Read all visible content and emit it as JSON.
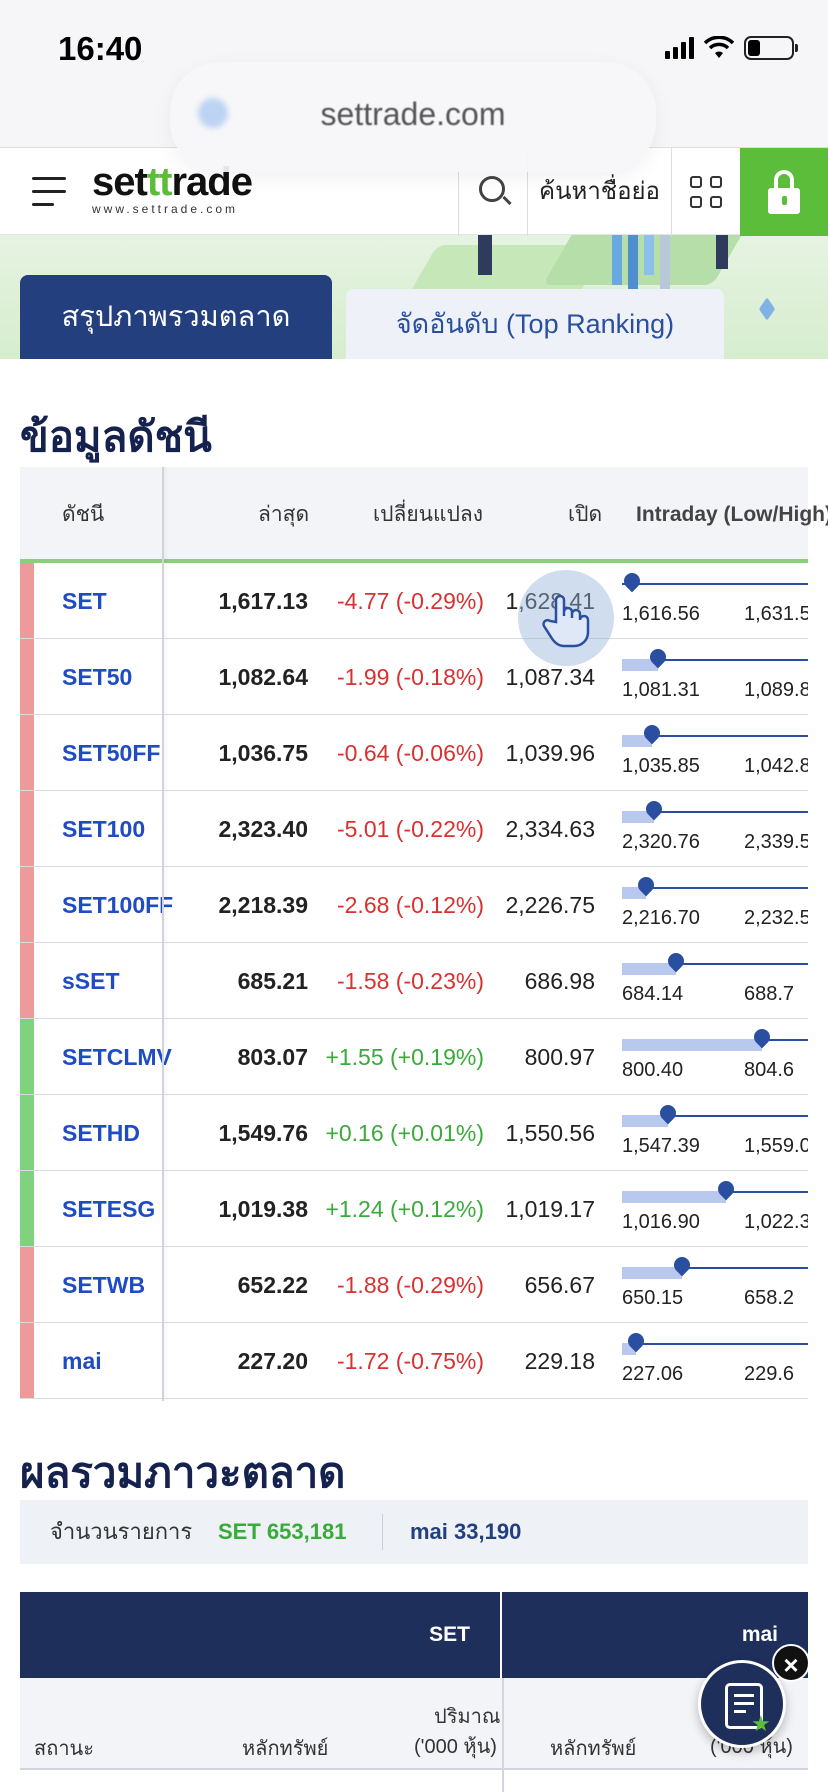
{
  "status_bar": {
    "time": "16:40"
  },
  "browser": {
    "url": "settrade.com"
  },
  "header": {
    "logo_main_a": "set",
    "logo_main_b": "tt",
    "logo_main_c": "rade",
    "logo_sub": "www.settrade.com",
    "symbol_search_label": "ค้นหาชื่อย่อ"
  },
  "tabs": {
    "active": "สรุปภาพรวมตลาด",
    "inactive": "จัดอันดับ (Top Ranking)"
  },
  "index_section": {
    "title": "ข้อมูลดัชนี",
    "headers": {
      "index": "ดัชนี",
      "last": "ล่าสุด",
      "change": "เปลี่ยนแปลง",
      "open": "เปิด",
      "intraday": "Intraday (Low/High)"
    },
    "rows": [
      {
        "symbol": "SET",
        "last": "1,617.13",
        "change": "-4.77 (-0.29%)",
        "open": "1,628.41",
        "low": "1,616.56",
        "high": "1,631.5",
        "direction": "down",
        "position": 0.05,
        "fill": 0.0
      },
      {
        "symbol": "SET50",
        "last": "1,082.64",
        "change": "-1.99 (-0.18%)",
        "open": "1,087.34",
        "low": "1,081.31",
        "high": "1,089.8",
        "direction": "down",
        "position": 0.18,
        "fill": 0.18
      },
      {
        "symbol": "SET50FF",
        "last": "1,036.75",
        "change": "-0.64 (-0.06%)",
        "open": "1,039.96",
        "low": "1,035.85",
        "high": "1,042.8",
        "direction": "down",
        "position": 0.15,
        "fill": 0.15
      },
      {
        "symbol": "SET100",
        "last": "2,323.40",
        "change": "-5.01 (-0.22%)",
        "open": "2,334.63",
        "low": "2,320.76",
        "high": "2,339.5",
        "direction": "down",
        "position": 0.16,
        "fill": 0.16
      },
      {
        "symbol": "SET100FF",
        "last": "2,218.39",
        "change": "-2.68 (-0.12%)",
        "open": "2,226.75",
        "low": "2,216.70",
        "high": "2,232.5",
        "direction": "down",
        "position": 0.12,
        "fill": 0.12
      },
      {
        "symbol": "sSET",
        "last": "685.21",
        "change": "-1.58 (-0.23%)",
        "open": "686.98",
        "low": "684.14",
        "high": "688.7",
        "direction": "down",
        "position": 0.27,
        "fill": 0.27
      },
      {
        "symbol": "SETCLMV",
        "last": "803.07",
        "change": "+1.55 (+0.19%)",
        "open": "800.97",
        "low": "800.40",
        "high": "804.6",
        "direction": "up",
        "position": 0.7,
        "fill": 0.7
      },
      {
        "symbol": "SETHD",
        "last": "1,549.76",
        "change": "+0.16 (+0.01%)",
        "open": "1,550.56",
        "low": "1,547.39",
        "high": "1,559.0",
        "direction": "up",
        "position": 0.23,
        "fill": 0.23
      },
      {
        "symbol": "SETESG",
        "last": "1,019.38",
        "change": "+1.24 (+0.12%)",
        "open": "1,019.17",
        "low": "1,016.90",
        "high": "1,022.3",
        "direction": "up",
        "position": 0.52,
        "fill": 0.52
      },
      {
        "symbol": "SETWB",
        "last": "652.22",
        "change": "-1.88 (-0.29%)",
        "open": "656.67",
        "low": "650.15",
        "high": "658.2",
        "direction": "down",
        "position": 0.3,
        "fill": 0.3
      },
      {
        "symbol": "mai",
        "last": "227.20",
        "change": "-1.72 (-0.75%)",
        "open": "229.18",
        "low": "227.06",
        "high": "229.6",
        "direction": "down",
        "position": 0.07,
        "fill": 0.07
      }
    ]
  },
  "market_section": {
    "title": "ผลรวมภาวะตลาด",
    "count_label": "จำนวนรายการ",
    "set_count": "SET 653,181",
    "mai_count": "mai 33,190",
    "table": {
      "group_set": "SET",
      "group_mai": "mai",
      "col_status": "สถานะ",
      "col_securities_set": "หลักทรัพย์",
      "col_volume_set_1": "ปริมาณ",
      "col_volume_set_2": "('000 หุ้น)",
      "col_securities_mai": "หลักทรัพย์",
      "col_volume_mai": "('000 หุ้น)"
    }
  },
  "colors": {
    "up": "#7fd37f",
    "down": "#ef9a9a",
    "accent_green": "#5cbd3a",
    "navy": "#233f7e"
  }
}
